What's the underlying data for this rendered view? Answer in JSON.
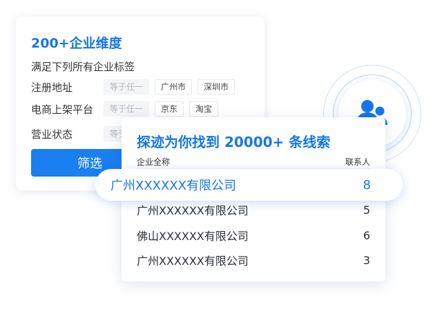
{
  "filter_card": {
    "title": "200+企业维度",
    "subtitle": "满足下列所有企业标签",
    "rows": [
      {
        "label": "注册地址",
        "condition": "等于任一",
        "tags": [
          "广州市",
          "深圳市"
        ]
      },
      {
        "label": "电商上架平台",
        "condition": "等于任一",
        "tags": [
          "京东",
          "淘宝"
        ]
      },
      {
        "label": "营业状态",
        "condition": "等于任一"
      }
    ],
    "button_label": "筛选"
  },
  "results_card": {
    "title": "探迹为你找到 20000+ 条线索",
    "columns": {
      "company": "企业全称",
      "contacts": "联系人"
    },
    "highlight": {
      "company": "广州XXXXXX有限公司",
      "contacts": "8"
    },
    "rows": [
      {
        "company": "广州XXXXXX有限公司",
        "contacts": "5"
      },
      {
        "company": "佛山XXXXXX有限公司",
        "contacts": "6"
      },
      {
        "company": "广州XXXXXX有限公司",
        "contacts": "3"
      }
    ]
  },
  "icon": {
    "name": "contacts-group-icon",
    "color": "#1677e6"
  },
  "colors": {
    "accent": "#1677e6",
    "button": "#1a7ff0"
  }
}
